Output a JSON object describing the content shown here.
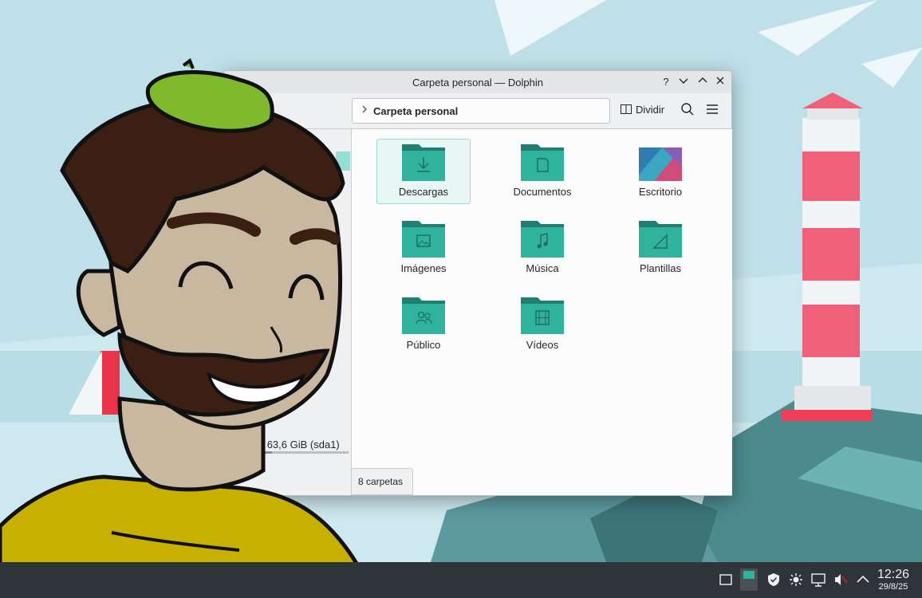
{
  "window": {
    "title": "Carpeta personal — Dolphin",
    "help_label": "?",
    "location": {
      "crumb": "Carpeta personal"
    },
    "toolbar": {
      "split_label": "Dividir"
    },
    "sidebar": {
      "disk_label": "erna de 63,6 GiB (sda1)",
      "disk_usage_fraction": 0.36
    },
    "items": [
      {
        "label": "Descargas",
        "icon": "download-folder-icon"
      },
      {
        "label": "Documentos",
        "icon": "documents-folder-icon"
      },
      {
        "label": "Escritorio",
        "icon": "desktop-folder-icon"
      },
      {
        "label": "Imágenes",
        "icon": "pictures-folder-icon"
      },
      {
        "label": "Música",
        "icon": "music-folder-icon"
      },
      {
        "label": "Plantillas",
        "icon": "templates-folder-icon"
      },
      {
        "label": "Público",
        "icon": "public-folder-icon"
      },
      {
        "label": "Vídeos",
        "icon": "videos-folder-icon"
      }
    ],
    "status": "8 carpetas"
  },
  "taskbar": {
    "clock": {
      "time": "12:26",
      "date": "29/8/25"
    }
  },
  "colors": {
    "folder": "#2fb39c",
    "folder_tab": "#1f7f6f",
    "selection": "#93e0d2",
    "taskbar": "#2f3438"
  }
}
